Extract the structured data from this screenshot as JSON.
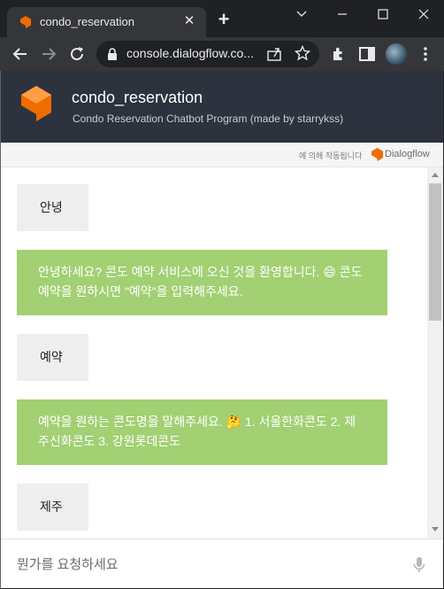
{
  "browser": {
    "tab_title": "condo_reservation",
    "tab_close": "✕",
    "new_tab": "+",
    "url": "console.dialogflow.co...",
    "colors": {
      "frame": "#202124",
      "toolbar": "#35363a",
      "favicon": "#ef6c00"
    }
  },
  "header": {
    "title": "condo_reservation",
    "subtitle": "Condo Reservation Chatbot Program (made by starrykss)",
    "colors": {
      "background": "#2d323f",
      "logo": "#ef6c00"
    }
  },
  "powered_by": {
    "text": "에 의해 작동됩니다",
    "brand": "Dialogflow"
  },
  "messages": [
    {
      "sender": "user",
      "text": "안녕"
    },
    {
      "sender": "bot",
      "text": "안녕하세요? 콘도 예약 서비스에 오신 것을 환영합니다. 😄 콘도 예약을 원하시면 \"예약\"을 입력해주세요."
    },
    {
      "sender": "user",
      "text": "예약"
    },
    {
      "sender": "bot",
      "text": "예약을 원하는 콘도명을 말해주세요. 🤔 1. 서울한화콘도 2. 제주신화콘도 3. 강원롯데콘도"
    },
    {
      "sender": "user",
      "text": "제주"
    }
  ],
  "chat_colors": {
    "user_bubble": "#eeeeee",
    "bot_bubble": "#a2d073",
    "bot_text": "#ffffff"
  },
  "input": {
    "placeholder": "뭔가를 요청하세요",
    "value": ""
  },
  "icons": [
    "back-arrow-icon",
    "forward-arrow-icon",
    "reload-icon",
    "lock-icon",
    "share-icon",
    "star-icon",
    "extensions-icon",
    "side-panel-icon",
    "menu-icon",
    "microphone-icon",
    "minimize-icon",
    "maximize-icon",
    "close-icon",
    "chevron-down-icon"
  ]
}
